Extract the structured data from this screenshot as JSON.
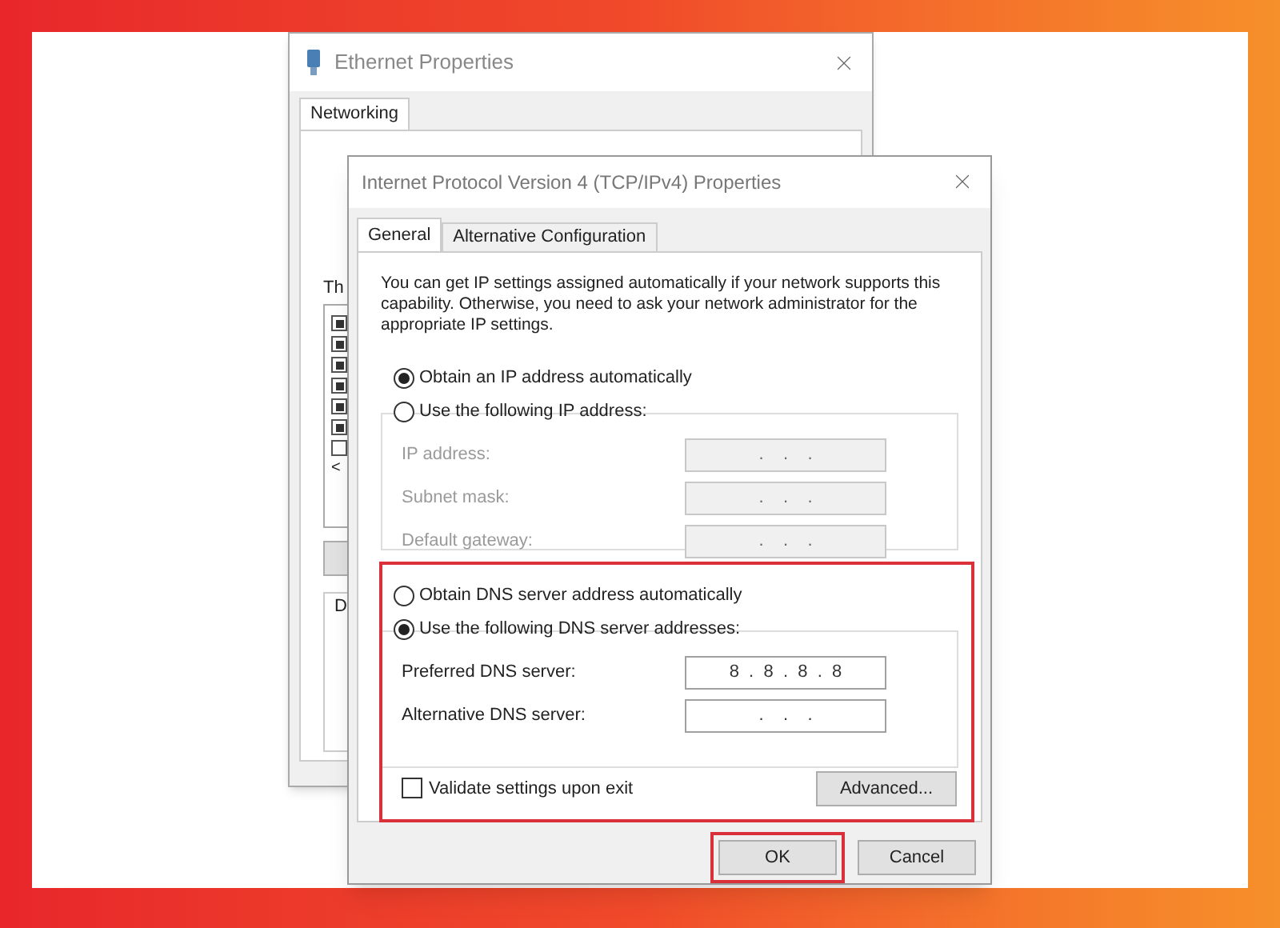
{
  "back_window": {
    "title": "Ethernet Properties",
    "tabs": [
      {
        "label": "Networking",
        "selected": true
      }
    ],
    "list_label": "Th",
    "list_items": [
      {
        "checked": true
      },
      {
        "checked": true
      },
      {
        "checked": true
      },
      {
        "checked": true
      },
      {
        "checked": true
      },
      {
        "checked": true
      },
      {
        "checked": false
      }
    ],
    "scroll_arrow": "<",
    "group_label": "D"
  },
  "dialog": {
    "title": "Internet Protocol Version 4 (TCP/IPv4) Properties",
    "tabs": [
      {
        "label": "General",
        "selected": true
      },
      {
        "label": "Alternative Configuration",
        "selected": false
      }
    ],
    "description": "You can get IP settings assigned automatically if your network supports this capability. Otherwise, you need to ask your network administrator for the appropriate IP settings.",
    "ip_options": [
      {
        "label": "Obtain an IP address automatically",
        "selected": true
      },
      {
        "label": "Use the following IP address:",
        "selected": false
      }
    ],
    "ip_fields": [
      {
        "label": "IP address:",
        "value": ".    .    .",
        "disabled": true
      },
      {
        "label": "Subnet mask:",
        "value": ".    .    .",
        "disabled": true
      },
      {
        "label": "Default gateway:",
        "value": ".    .    .",
        "disabled": true
      }
    ],
    "dns_section": {
      "highlighted": true,
      "options": [
        {
          "label": "Obtain DNS server address automatically",
          "selected": false
        },
        {
          "label": "Use the following DNS server addresses:",
          "selected": true
        }
      ],
      "fields": [
        {
          "label": "Preferred DNS server:",
          "value": "8  .  8  .  8  .  8",
          "disabled": false
        },
        {
          "label": "Alternative DNS server:",
          "value": ".    .    .",
          "disabled": false
        }
      ],
      "validate": {
        "label": "Validate settings upon exit",
        "checked": false
      },
      "advanced": "Advanced..."
    },
    "buttons": [
      {
        "label": "OK",
        "highlighted": true
      },
      {
        "label": "Cancel",
        "highlighted": false
      }
    ]
  }
}
